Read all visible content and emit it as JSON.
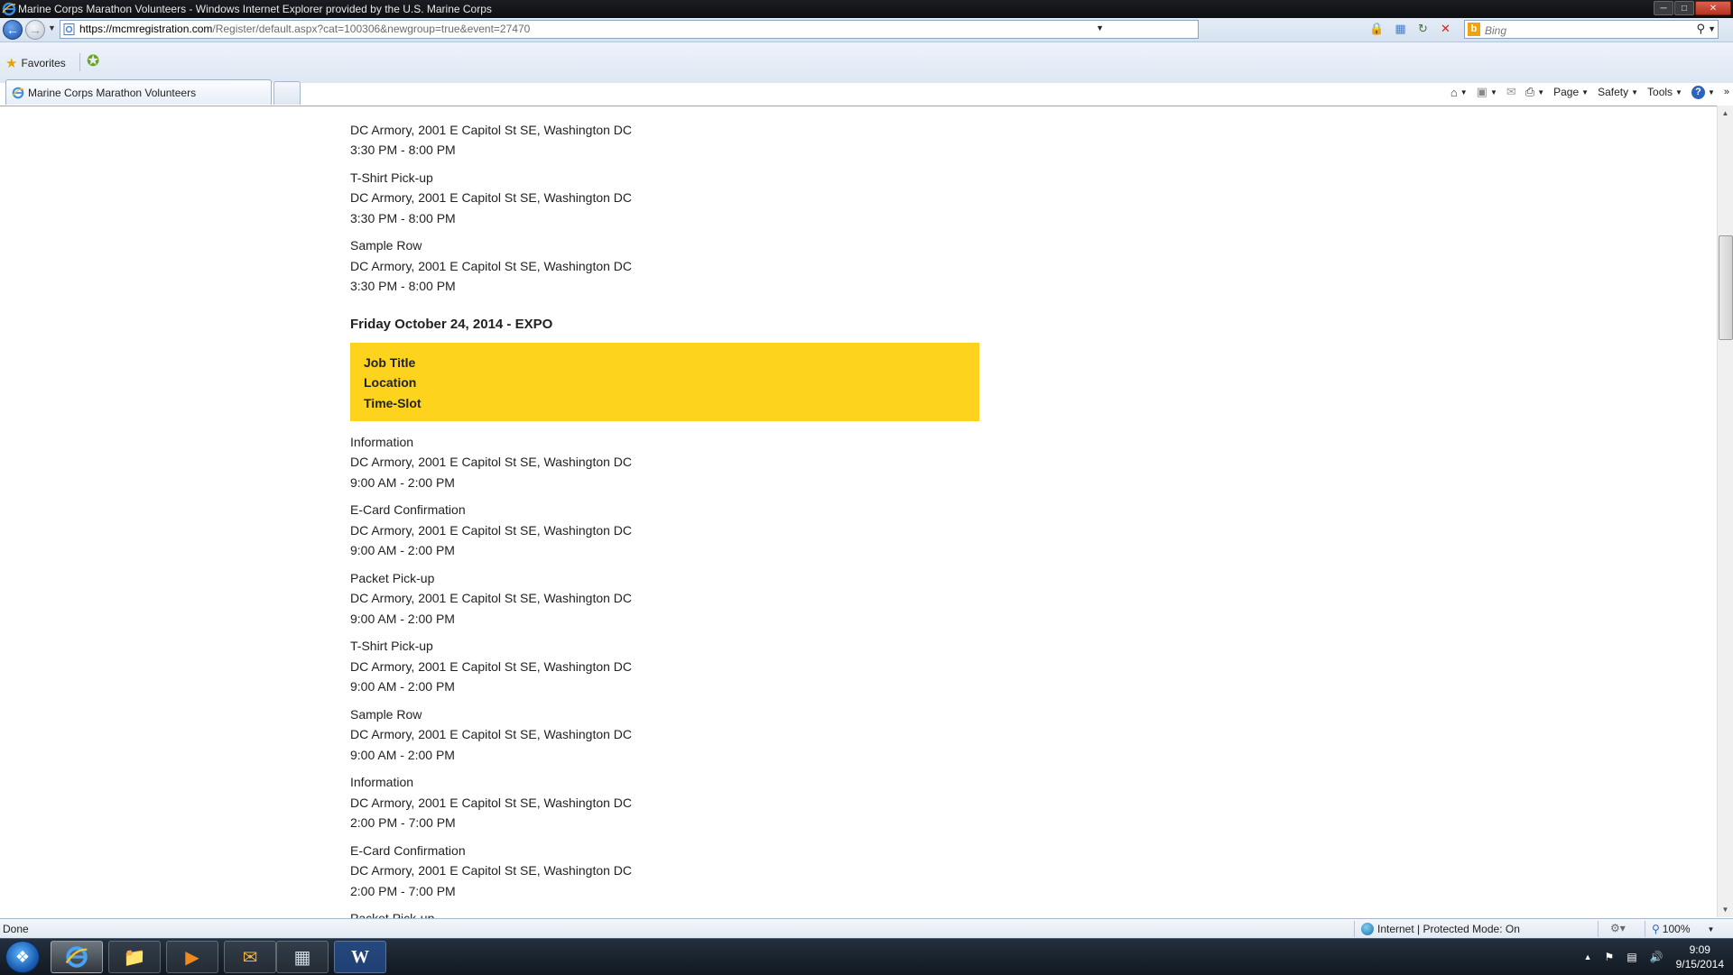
{
  "window": {
    "title": "Marine Corps Marathon Volunteers - Windows Internet Explorer provided by the U.S. Marine Corps"
  },
  "address": {
    "url_host": "https://mcmregistration.com",
    "url_path": "/Register/default.aspx?cat=100306&newgroup=true&event=27470"
  },
  "search": {
    "placeholder": "Bing"
  },
  "favorites": {
    "label": "Favorites"
  },
  "tab": {
    "title": "Marine Corps Marathon Volunteers"
  },
  "commands": {
    "page": "Page",
    "safety": "Safety",
    "tools": "Tools"
  },
  "content": {
    "prev_jobs": [
      {
        "title": "",
        "location": "DC Armory, 2001 E Capitol St SE, Washington DC",
        "time": "3:30 PM - 8:00 PM"
      },
      {
        "title": "T-Shirt Pick-up",
        "location": "DC Armory, 2001 E Capitol St SE, Washington DC",
        "time": "3:30 PM - 8:00 PM"
      },
      {
        "title": "Sample Row",
        "location": "DC Armory, 2001 E Capitol St SE, Washington DC",
        "time": "3:30 PM - 8:00 PM"
      }
    ],
    "day_heading": "Friday October 24, 2014 - EXPO",
    "header": {
      "col1": "Job Title",
      "col2": "Location",
      "col3": "Time-Slot"
    },
    "jobs": [
      {
        "title": "Information",
        "location": "DC Armory, 2001 E Capitol St SE, Washington DC",
        "time": "9:00 AM - 2:00 PM"
      },
      {
        "title": "E-Card Confirmation",
        "location": "DC Armory, 2001 E Capitol St SE, Washington DC",
        "time": "9:00 AM - 2:00 PM"
      },
      {
        "title": "Packet Pick-up",
        "location": "DC Armory, 2001 E Capitol St SE, Washington DC",
        "time": "9:00 AM - 2:00 PM"
      },
      {
        "title": "T-Shirt Pick-up",
        "location": "DC Armory, 2001 E Capitol St SE, Washington DC",
        "time": "9:00 AM - 2:00 PM"
      },
      {
        "title": "Sample Row",
        "location": "DC Armory, 2001 E Capitol St SE, Washington DC",
        "time": "9:00 AM - 2:00 PM"
      },
      {
        "title": "Information",
        "location": "DC Armory, 2001 E Capitol St SE, Washington DC",
        "time": "2:00 PM - 7:00 PM"
      },
      {
        "title": "E-Card Confirmation",
        "location": "DC Armory, 2001 E Capitol St SE, Washington DC",
        "time": "2:00 PM - 7:00 PM"
      },
      {
        "title": "Packet Pick-up",
        "location": "",
        "time": ""
      }
    ]
  },
  "status": {
    "text": "Done",
    "zone": "Internet | Protected Mode: On",
    "zoom": "100%"
  },
  "taskbar": {
    "time": "9:09",
    "date": "9/15/2014"
  },
  "colors": {
    "header_yellow": "#fed31d",
    "ie_blue": "#1b4f9e"
  }
}
